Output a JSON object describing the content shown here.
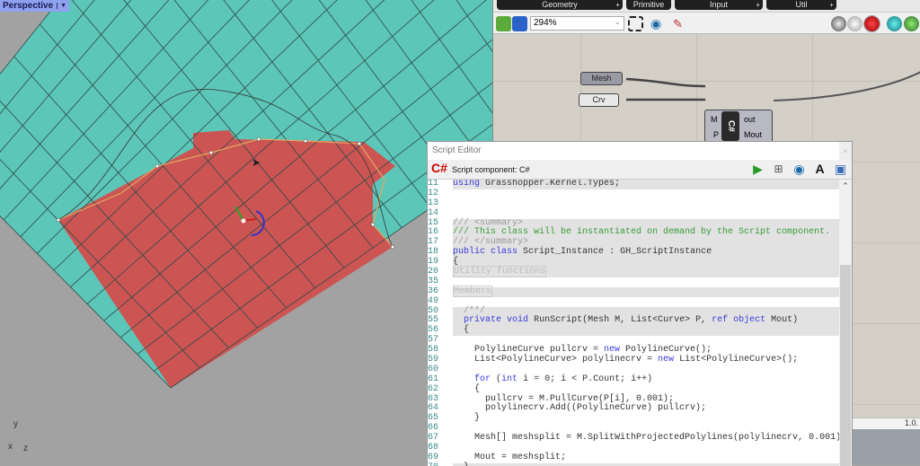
{
  "viewport": {
    "label": "Perspective",
    "axes": {
      "y": "y",
      "x": "x",
      "z": "z"
    }
  },
  "colors": {
    "mesh_teal": "#5cc6b8",
    "mesh_red": "#cc5553",
    "curve": "#e0a860"
  },
  "grasshopper": {
    "tabs": [
      "Geometry",
      "Primitive",
      "Input",
      "Util"
    ],
    "zoom": "294%",
    "params": [
      {
        "label": "Mesh"
      },
      {
        "label": "Crv"
      }
    ],
    "component": {
      "inputs": [
        "M",
        "P"
      ],
      "outputs": [
        "out",
        "Mout"
      ],
      "name": "C#"
    },
    "status": "1.0."
  },
  "editor": {
    "title": "Script Editor",
    "close": "×",
    "component_label": "Script component: C#",
    "lines": [
      {
        "n": "11",
        "t": "using Grasshopper.Kernel.Types;",
        "g": true
      },
      {
        "n": "12",
        "t": "",
        "g": true
      },
      {
        "n": "13",
        "t": "",
        "g": false
      },
      {
        "n": "14",
        "t": "",
        "g": true
      },
      {
        "n": "15",
        "t": "/// <summary>",
        "g": true,
        "c": "cmg"
      },
      {
        "n": "16",
        "t": "/// This class will be instantiated on demand by the Script component.",
        "g": true,
        "c": "cm"
      },
      {
        "n": "17",
        "t": "/// </summary>",
        "g": true,
        "c": "cmg"
      },
      {
        "n": "18",
        "t": "public class Script_Instance : GH_ScriptInstance",
        "g": true
      },
      {
        "n": "19",
        "t": "{",
        "g": true
      },
      {
        "n": "20",
        "t": "Utility functions",
        "g": true,
        "c": "fold"
      },
      {
        "n": "35",
        "t": "",
        "g": true
      },
      {
        "n": "36",
        "t": "Members",
        "g": true,
        "c": "fold"
      },
      {
        "n": "49",
        "t": "",
        "g": true
      },
      {
        "n": "50",
        "t": "  /**/",
        "g": true,
        "c": "cmg"
      },
      {
        "n": "55",
        "t": "  private void RunScript(Mesh M, List<Curve> P, ref object Mout)",
        "g": true
      },
      {
        "n": "56",
        "t": "  {",
        "g": true
      },
      {
        "n": "57",
        "t": "",
        "g": false
      },
      {
        "n": "58",
        "t": "    PolylineCurve pullcrv = new PolylineCurve();",
        "g": false
      },
      {
        "n": "59",
        "t": "    List<PolylineCurve> polylinecrv = new List<PolylineCurve>();",
        "g": false
      },
      {
        "n": "60",
        "t": "",
        "g": false
      },
      {
        "n": "61",
        "t": "    for (int i = 0; i < P.Count; i++)",
        "g": false
      },
      {
        "n": "62",
        "t": "    {",
        "g": false
      },
      {
        "n": "63",
        "t": "      pullcrv = M.PullCurve(P[i], 0.001);",
        "g": false
      },
      {
        "n": "64",
        "t": "      polylinecrv.Add((PolylineCurve) pullcrv);",
        "g": false
      },
      {
        "n": "65",
        "t": "    }",
        "g": false
      },
      {
        "n": "66",
        "t": "",
        "g": false
      },
      {
        "n": "67",
        "t": "    Mesh[] meshsplit = M.SplitWithProjectedPolylines(polylinecrv, 0.001);",
        "g": false
      },
      {
        "n": "68",
        "t": "",
        "g": false
      },
      {
        "n": "69",
        "t": "    Mout = meshsplit;",
        "g": false
      },
      {
        "n": "70",
        "t": "  }",
        "g": true
      }
    ]
  }
}
